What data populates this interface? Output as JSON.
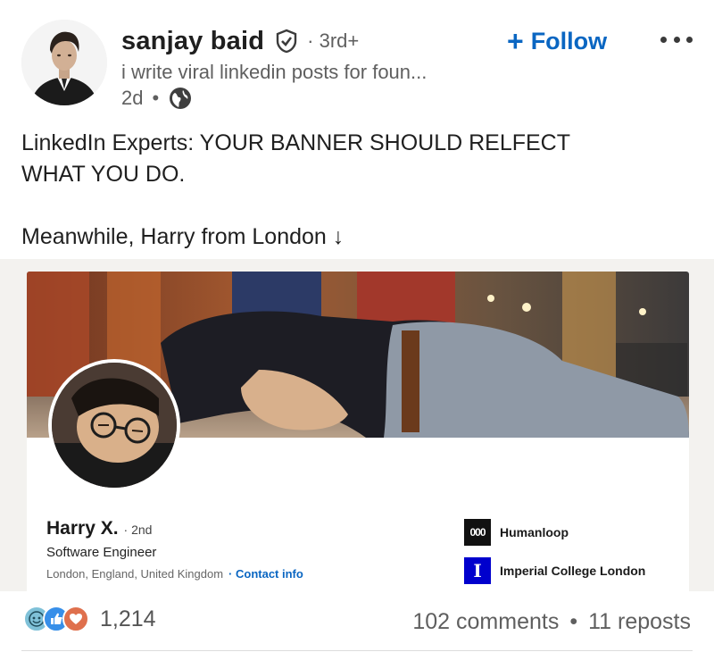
{
  "author": {
    "name": "sanjay baid",
    "degree": "3rd+",
    "headline": "i write viral linkedin posts for foun...",
    "time": "2d",
    "visibility_icon": "globe-icon",
    "verified_icon": "verified-shield-icon"
  },
  "actions": {
    "follow_label": "Follow",
    "follow_icon": "plus-icon",
    "more_icon": "more-options-icon"
  },
  "post": {
    "line1": "LinkedIn Experts: YOUR BANNER SHOULD RELFECT",
    "line2": "WHAT YOU DO.",
    "line3": "Meanwhile, Harry from London ↓"
  },
  "profile_card": {
    "name": "Harry X.",
    "degree": "· 2nd",
    "title": "Software Engineer",
    "location": "London, England, United Kingdom",
    "contact_label": "· Contact info",
    "company": {
      "logo_text": "000",
      "name": "Humanloop"
    },
    "school": {
      "logo_text": "I",
      "name": "Imperial College London"
    }
  },
  "social": {
    "reaction_count": "1,214",
    "comments": "102 comments",
    "separator": "•",
    "reposts": "11 reposts",
    "reaction_icons": [
      "support-icon",
      "like-icon",
      "love-icon"
    ]
  },
  "colors": {
    "brand_blue": "#0a66c2",
    "text_secondary": "#5f5f5f",
    "imperial_blue": "#0000cd"
  }
}
